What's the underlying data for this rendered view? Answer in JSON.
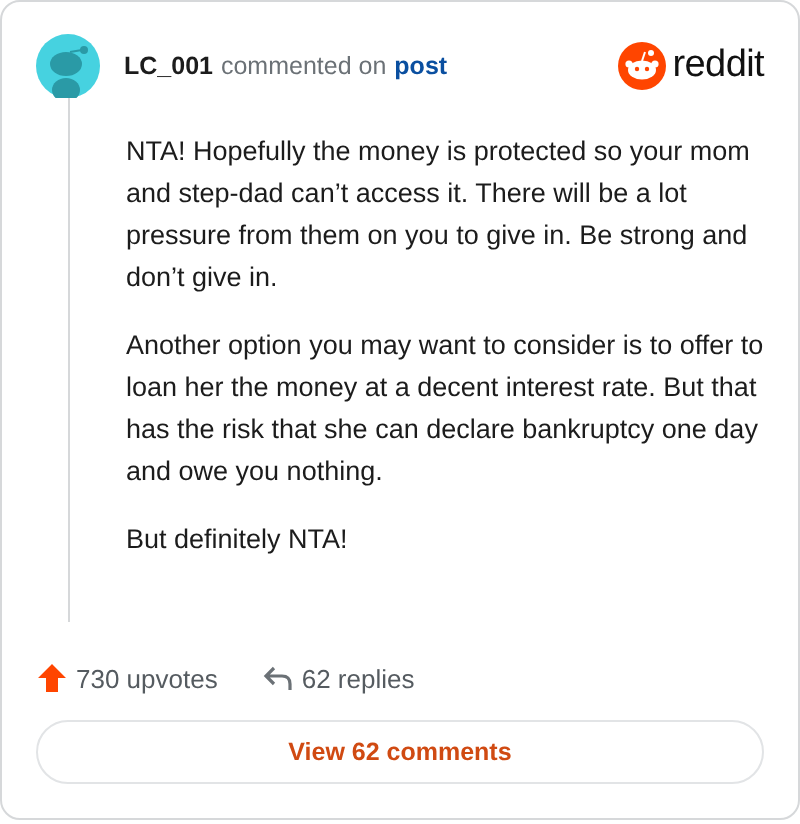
{
  "comment": {
    "author": "LC_001",
    "action": "commented on",
    "target": "post"
  },
  "brand": {
    "name": "reddit"
  },
  "paragraphs": [
    "NTA! Hopefully the money is protected so your mom and step-dad can’t access it. There will be a lot pressure from them on you to give in. Be strong and don’t give in.",
    "Another option you may want to consider is to offer to loan her the money at a decent interest rate. But that has the risk that she can declare bankruptcy one day and owe you nothing.",
    "But definitely NTA!"
  ],
  "stats": {
    "upvotes": "730 upvotes",
    "replies": "62 replies"
  },
  "view_button": "View 62 comments"
}
